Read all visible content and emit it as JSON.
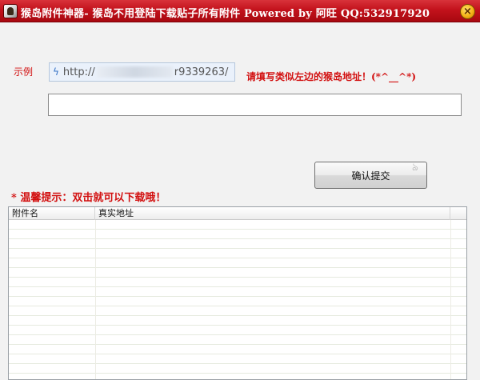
{
  "window": {
    "title": "猴岛附件神器- 猴岛不用登陆下载贴子所有附件 Powered by 阿旺 QQ:532917920",
    "close_glyph": "×"
  },
  "example": {
    "label": "示例",
    "url_prefix": "http://",
    "url_suffix": "r9339263/",
    "hint": "请填写类似左边的猴岛地址！(*^__^*)"
  },
  "url_input": {
    "value": "",
    "placeholder": ""
  },
  "confirm_button": {
    "label": "确认提交"
  },
  "tip": {
    "text": "* 温馨提示：双击就可以下载哦！"
  },
  "table": {
    "columns": [
      "附件名",
      "真实地址"
    ],
    "rows": []
  },
  "colors": {
    "accent_red": "#d21010",
    "titlebar": "#c3121c"
  }
}
